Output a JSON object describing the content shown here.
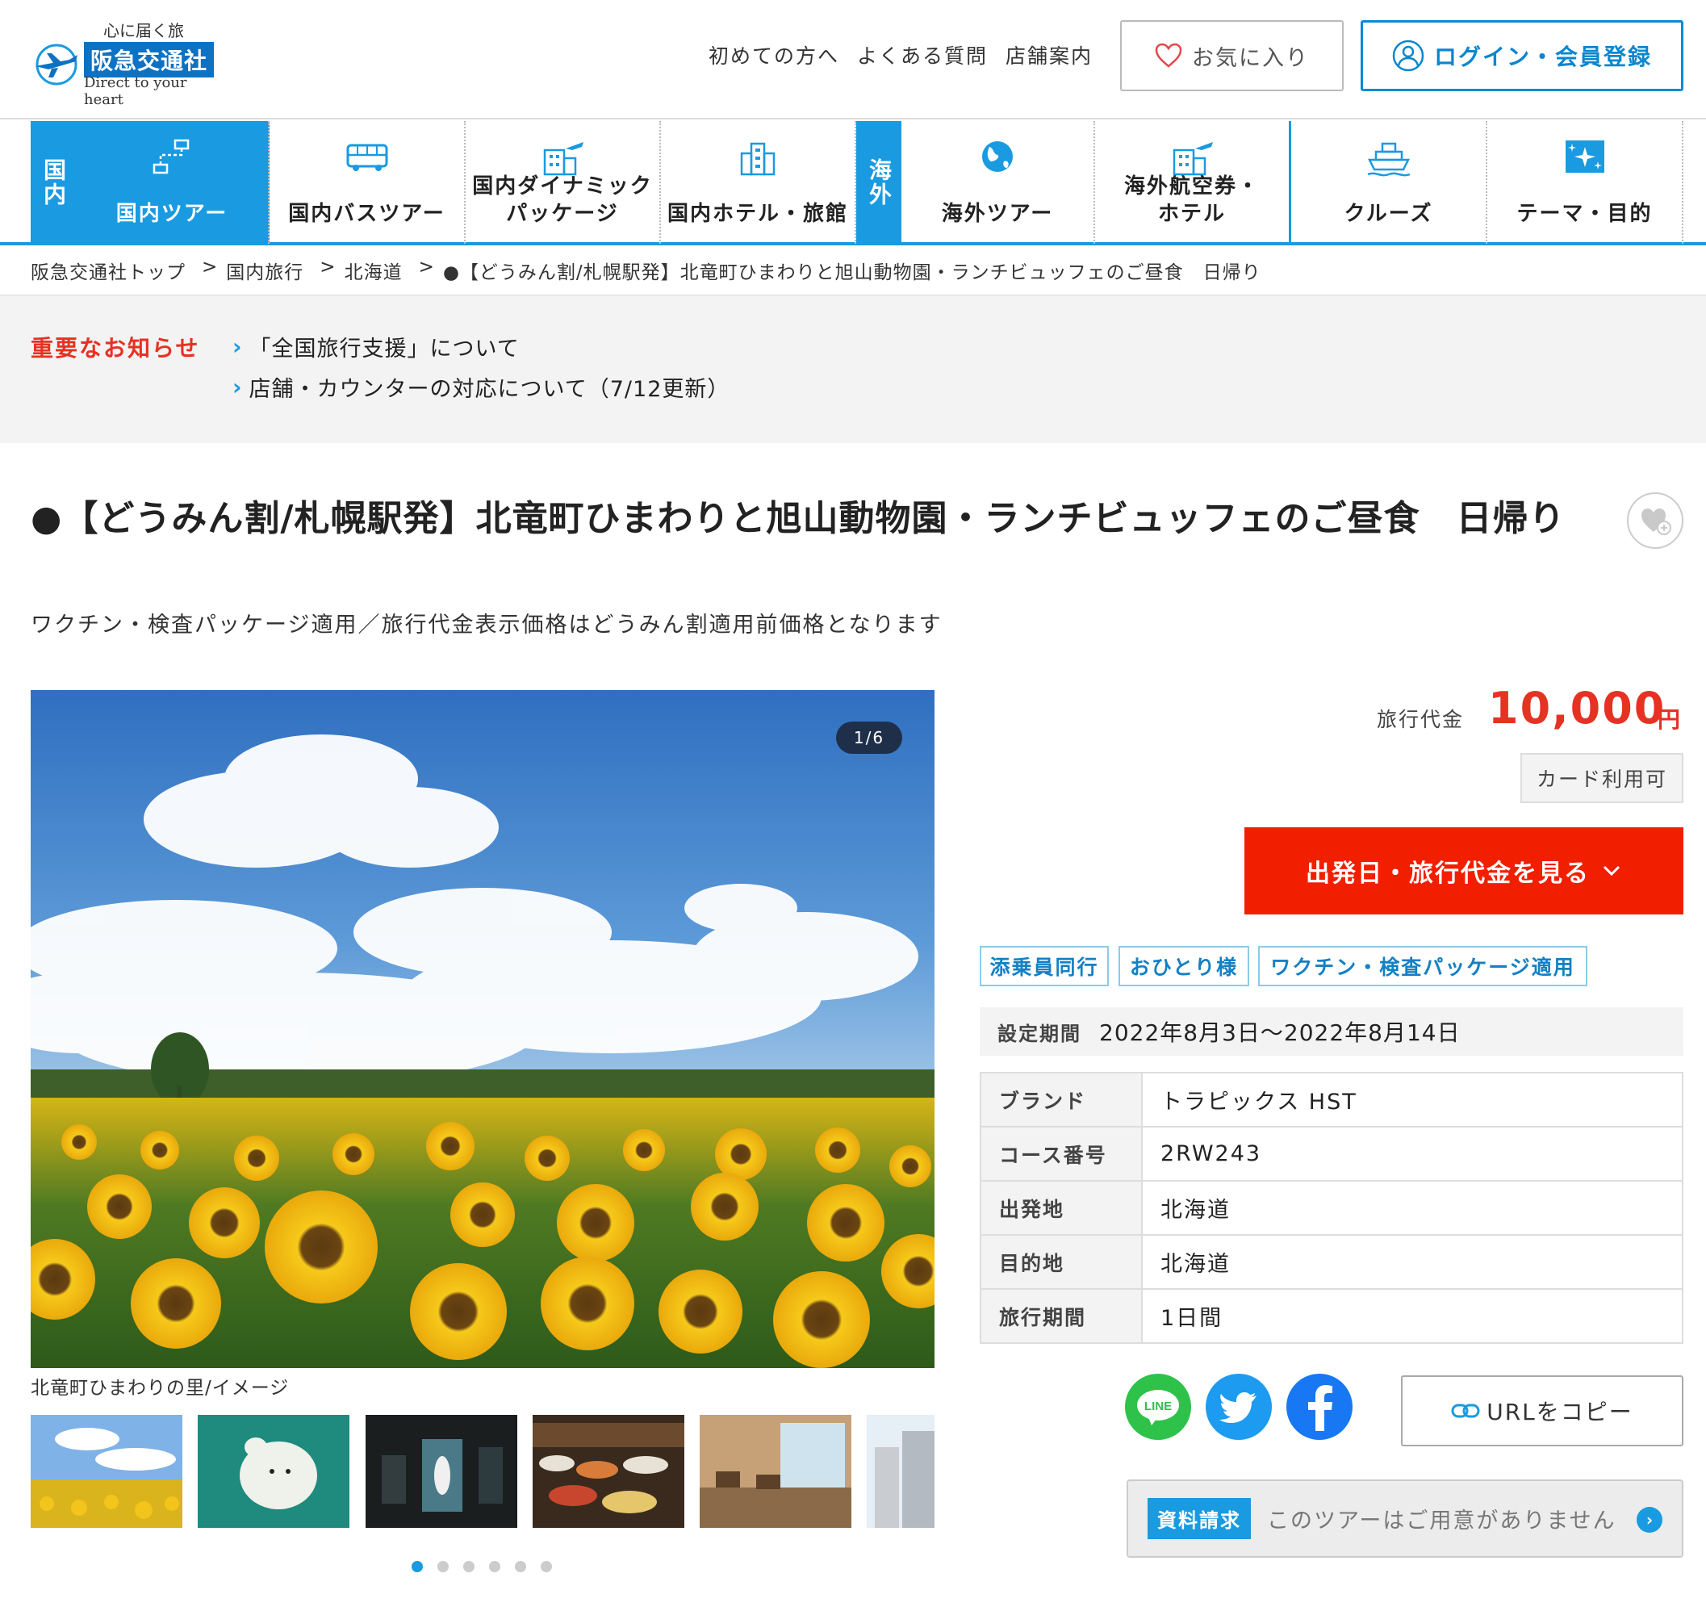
{
  "header": {
    "logo_tagline": "心に届く旅",
    "logo_name": "阪急交通社",
    "logo_english": "Direct to your heart",
    "links": [
      "初めての方へ",
      "よくある質問",
      "店舗案内"
    ],
    "favorites_label": "お気に入り",
    "login_label": "ログイン・会員登録"
  },
  "nav": {
    "domestic_side": "国内",
    "overseas_side": "海外",
    "items": [
      {
        "label": "国内ツアー"
      },
      {
        "label": "国内バスツアー"
      },
      {
        "label": "国内ダイナミック\nパッケージ"
      },
      {
        "label": "国内ホテル・旅館"
      },
      {
        "label": "海外ツアー"
      },
      {
        "label": "海外航空券・\nホテル"
      },
      {
        "label": "クルーズ"
      },
      {
        "label": "テーマ・目的"
      }
    ]
  },
  "breadcrumb": {
    "items": [
      "阪急交通社トップ",
      "国内旅行",
      "北海道",
      "●【どうみん割/札幌駅発】北竜町ひまわりと旭山動物園・ランチビュッフェのご昼食　日帰り"
    ],
    "separator": ">"
  },
  "notice": {
    "label": "重要なお知らせ",
    "items": [
      "「全国旅行支援」について",
      "店舗・カウンターの対応について（7/12更新）"
    ]
  },
  "tour": {
    "title": "●【どうみん割/札幌駅発】北竜町ひまわりと旭山動物園・ランチビュッフェのご昼食　日帰り",
    "subtitle": "ワクチン・検査パッケージ適用／旅行代金表示価格はどうみん割適用前価格となります",
    "image_counter": "1/6",
    "image_caption": "北竜町ひまわりの里/イメージ",
    "price_label": "旅行代金",
    "price": "10,000",
    "price_unit": "円",
    "card_badge": "カード利用可",
    "cta_label": "出発日・旅行代金を見る",
    "tags": [
      "添乗員同行",
      "おひとり様",
      "ワクチン・検査パッケージ適用"
    ],
    "period_label": "設定期間",
    "period_value": "2022年8月3日〜2022年8月14日",
    "info": [
      {
        "key": "ブランド",
        "value": "トラピックス HST"
      },
      {
        "key": "コース番号",
        "value": "2RW243"
      },
      {
        "key": "出発地",
        "value": "北海道"
      },
      {
        "key": "目的地",
        "value": "北海道"
      },
      {
        "key": "旅行期間",
        "value": "1日間"
      }
    ],
    "copy_url_label": "URLをコピー",
    "request_badge": "資料請求",
    "request_text": "このツアーはご用意がありません",
    "slides_total": 6,
    "slide_current": 1
  },
  "social": {
    "line_label": "LINE"
  },
  "colors": {
    "accent_blue": "#1a9ae0",
    "price_red": "#e53222",
    "cta_red": "#f21e00"
  }
}
